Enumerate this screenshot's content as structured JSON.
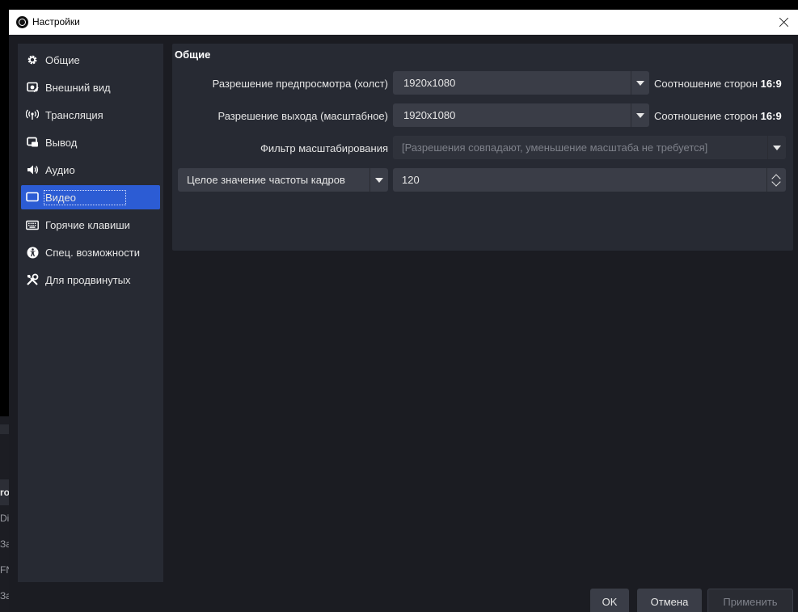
{
  "window": {
    "title": "Настройки"
  },
  "sidebar": {
    "items": [
      {
        "label": "Общие",
        "icon": "gear-icon"
      },
      {
        "label": "Внешний вид",
        "icon": "appearance-icon"
      },
      {
        "label": "Трансляция",
        "icon": "broadcast-icon"
      },
      {
        "label": "Вывод",
        "icon": "output-icon"
      },
      {
        "label": "Аудио",
        "icon": "speaker-icon"
      },
      {
        "label": "Видео",
        "icon": "monitor-icon",
        "active": true
      },
      {
        "label": "Горячие клавиши",
        "icon": "keyboard-icon"
      },
      {
        "label": "Спец. возможности",
        "icon": "accessibility-icon"
      },
      {
        "label": "Для продвинутых",
        "icon": "tools-icon"
      }
    ]
  },
  "main": {
    "group_title": "Общие",
    "base_resolution": {
      "label": "Разрешение предпросмотра (холст)",
      "value": "1920x1080",
      "aspect_prefix": "Соотношение сторон",
      "aspect_value": "16:9"
    },
    "output_resolution": {
      "label": "Разрешение выхода (масштабное)",
      "value": "1920x1080",
      "aspect_prefix": "Соотношение сторон",
      "aspect_value": "16:9"
    },
    "downscale_filter": {
      "label": "Фильтр масштабирования",
      "value": "[Разрешения совпадают, уменьшение масштаба не требуется]"
    },
    "fps": {
      "type_value": "Целое значение частоты кадров",
      "value": "120"
    }
  },
  "buttons": {
    "ok": "OK",
    "cancel": "Отмена",
    "apply": "Применить"
  },
  "background_app": {
    "rows": [
      "ro",
      "Di",
      "За",
      "FN",
      "За"
    ]
  },
  "colors": {
    "accent": "#2c5cd4",
    "panel": "#272a33",
    "window_bg": "#1b1c22",
    "control": "#3a3d47"
  }
}
